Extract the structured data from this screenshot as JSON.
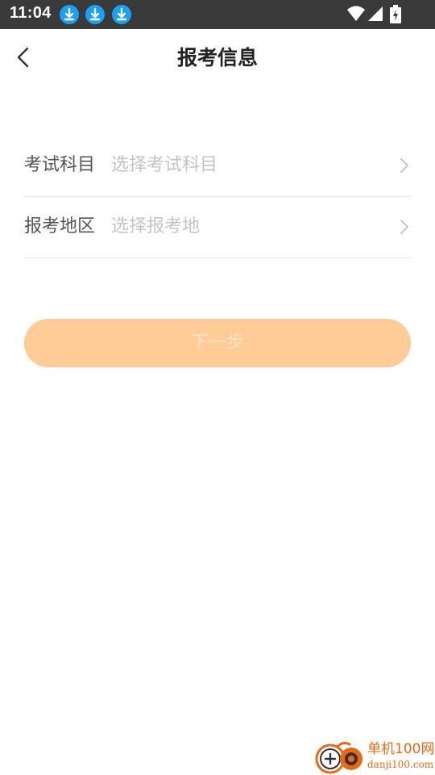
{
  "status_bar": {
    "time": "11:04",
    "icons": [
      "download-icon",
      "download-icon",
      "download-icon",
      "wifi-icon",
      "signal-icon",
      "battery-charging-icon"
    ]
  },
  "nav": {
    "title": "报考信息",
    "back_icon": "chevron-left-icon"
  },
  "form": {
    "rows": [
      {
        "label": "考试科目",
        "placeholder": "选择考试科目",
        "icon": "chevron-right-icon"
      },
      {
        "label": "报考地区",
        "placeholder": "选择报考地",
        "icon": "chevron-right-icon"
      }
    ]
  },
  "next_button": {
    "label": "下一步",
    "color": "#ffcb97",
    "state": "disabled"
  },
  "watermark": {
    "name": "单机100网",
    "domain": "danji100.com"
  },
  "colors": {
    "status_bar": "#3a3a3a",
    "accent": "#ffcb97",
    "download_badge": "#1aa0f5",
    "watermark": "#e86a17"
  }
}
